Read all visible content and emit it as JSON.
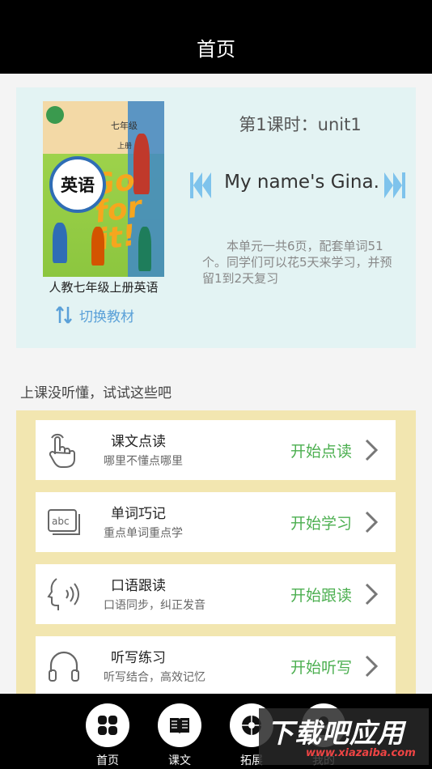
{
  "header": {
    "title": "首页"
  },
  "book": {
    "cover": {
      "grade": "七年级",
      "volume": "上册",
      "subject": "英语",
      "slogan": "Go for it!"
    },
    "name": "人教七年级上册英语",
    "switch_label": "切换教材"
  },
  "lesson": {
    "title": "第1课时：unit1",
    "unit_name": "My name's Gina.",
    "description": "本单元一共6页，配套单词51个。同学们可以花5天来学习，并预留1到2天复习"
  },
  "section": {
    "label": "上课没听懂，试试这些吧"
  },
  "features": [
    {
      "icon": "hand-pointer-icon",
      "title": "课文点读",
      "subtitle": "哪里不懂点哪里",
      "action": "开始点读"
    },
    {
      "icon": "abc-cards-icon",
      "title": "单词巧记",
      "subtitle": "重点单词重点学",
      "action": "开始学习"
    },
    {
      "icon": "speaking-head-icon",
      "title": "口语跟读",
      "subtitle": "口语同步，纠正发音",
      "action": "开始跟读"
    },
    {
      "icon": "headphones-icon",
      "title": "听写练习",
      "subtitle": "听写结合，高效记忆",
      "action": "开始听写"
    }
  ],
  "bottom_nav": [
    {
      "icon": "grid-icon",
      "label": "首页"
    },
    {
      "icon": "book-open-icon",
      "label": "课文"
    },
    {
      "icon": "ball-icon",
      "label": "拓展"
    },
    {
      "icon": "profile-icon",
      "label": "我的"
    }
  ],
  "watermark": {
    "title": "下载吧应用",
    "url": "www.xiazaiba.com"
  },
  "colors": {
    "accent_green": "#4caf50",
    "accent_blue": "#5aa0d8",
    "card_bg": "#e3f3f3",
    "feature_bg": "#f2e6b0"
  }
}
